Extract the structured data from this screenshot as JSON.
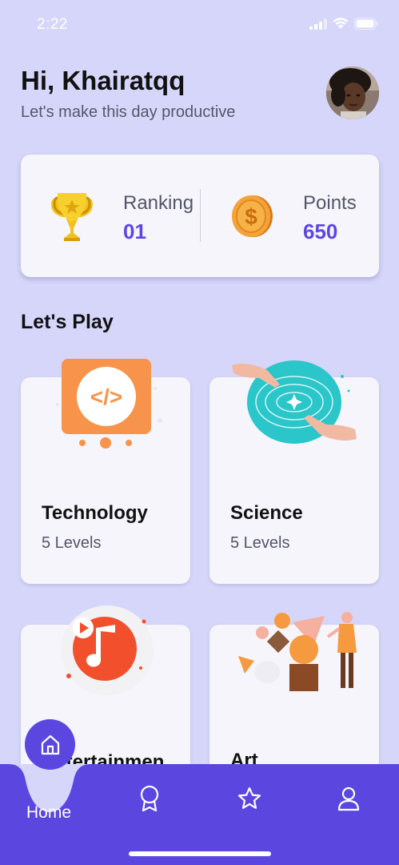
{
  "status_bar": {
    "time": "2:22"
  },
  "header": {
    "greeting": "Hi, Khairatqq",
    "subtitle": "Let's make this day productive"
  },
  "stats": {
    "ranking_label": "Ranking",
    "ranking_value": "01",
    "points_label": "Points",
    "points_value": "650"
  },
  "section_title": "Let's Play",
  "categories": [
    {
      "name": "Technology",
      "levels": "5 Levels"
    },
    {
      "name": "Science",
      "levels": "5 Levels"
    },
    {
      "name": "Entertainmen\nt",
      "levels": ""
    },
    {
      "name": "Art",
      "levels": ""
    }
  ],
  "bottom_nav": {
    "home_label": "Home",
    "items": [
      "home-icon",
      "award-icon",
      "star-icon",
      "profile-icon"
    ]
  },
  "colors": {
    "background": "#d6d6fb",
    "accent": "#5b47e0",
    "card": "#f5f5fb"
  }
}
